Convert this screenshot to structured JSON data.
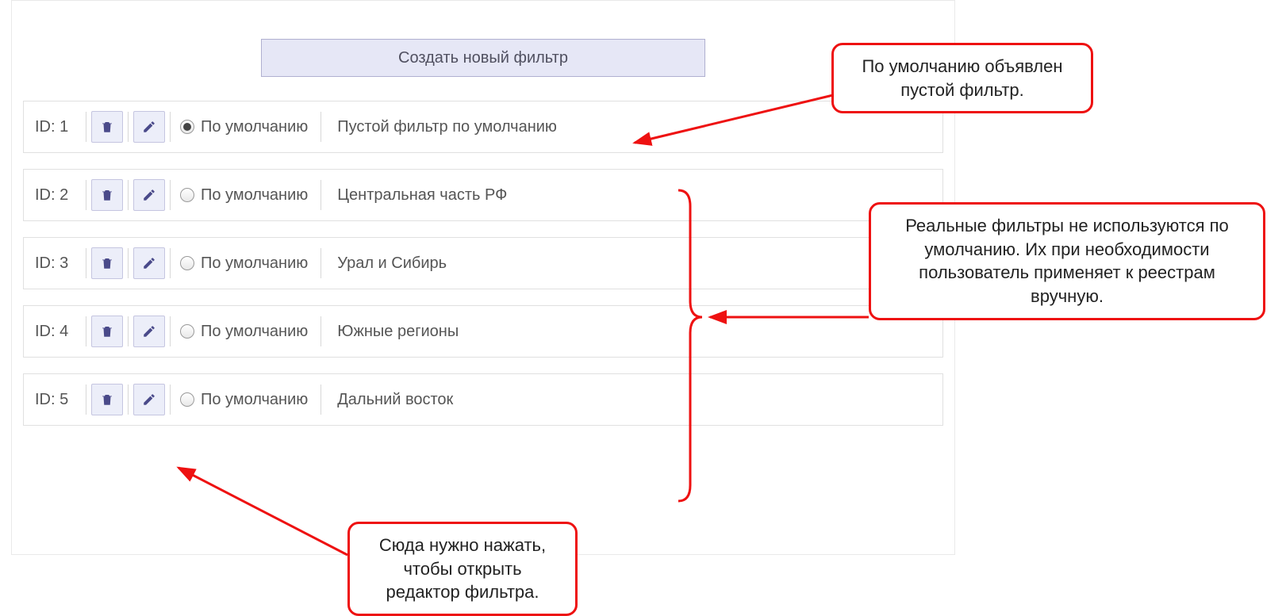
{
  "createButton": "Создать новый фильтр",
  "idPrefix": "ID: ",
  "defaultLabel": "По умолчанию",
  "rows": [
    {
      "id": "1",
      "selected": true,
      "name": "Пустой фильтр по умолчанию"
    },
    {
      "id": "2",
      "selected": false,
      "name": "Центральная часть РФ"
    },
    {
      "id": "3",
      "selected": false,
      "name": "Урал и Сибирь"
    },
    {
      "id": "4",
      "selected": false,
      "name": "Южные регионы"
    },
    {
      "id": "5",
      "selected": false,
      "name": "Дальний восток"
    }
  ],
  "callouts": {
    "c1": "По умолчанию объявлен пустой фильтр.",
    "c2": "Реальные фильтры не используются по умолчанию. Их при необходимости пользователь применяет к реестрам вручную.",
    "c3": "Сюда нужно нажать, чтобы открыть редактор фильтра."
  }
}
